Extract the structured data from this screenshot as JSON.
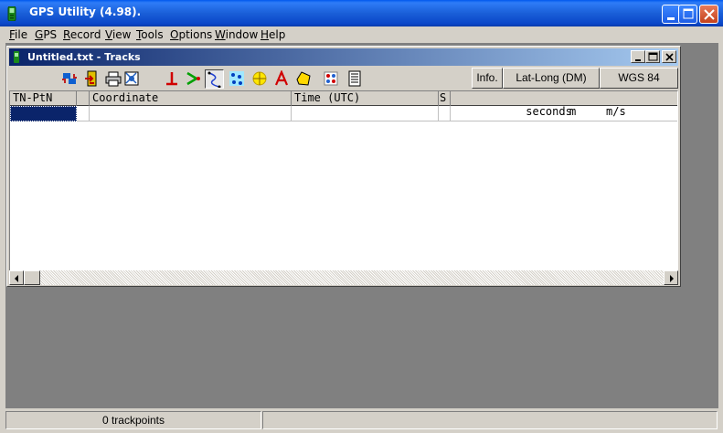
{
  "app": {
    "title": "GPS Utility (4.98)."
  },
  "menu": [
    {
      "pre": "",
      "ul": "F",
      "post": "ile"
    },
    {
      "pre": "",
      "ul": "G",
      "post": "PS"
    },
    {
      "pre": "",
      "ul": "R",
      "post": "ecord"
    },
    {
      "pre": "",
      "ul": "V",
      "post": "iew"
    },
    {
      "pre": "",
      "ul": "T",
      "post": "ools"
    },
    {
      "pre": "",
      "ul": "O",
      "post": "ptions"
    },
    {
      "pre": "",
      "ul": "W",
      "post": "indow"
    },
    {
      "pre": "",
      "ul": "H",
      "post": "elp"
    }
  ],
  "child": {
    "title": "Untitled.txt - Tracks"
  },
  "toolbar": {
    "info_label": "Info.",
    "coord_format": "Lat-Long (DM)",
    "datum": "WGS 84"
  },
  "grid": {
    "headers": [
      "TN-PtN",
      "",
      "Coordinate",
      "Time (UTC)",
      "S",
      "seconds",
      "m",
      "m/s"
    ]
  },
  "status": {
    "trackpoints": "0 trackpoints"
  },
  "colors": {
    "titlebar": "#0a46c8",
    "child_titlebar": "#0a246a",
    "mdi_background": "#808080"
  }
}
